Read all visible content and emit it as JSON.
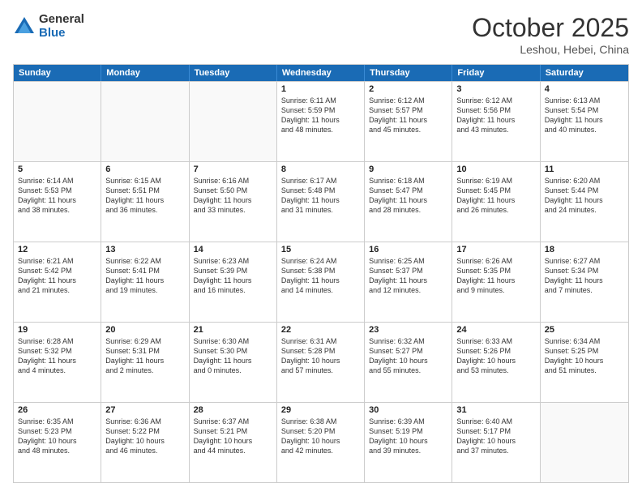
{
  "logo": {
    "general": "General",
    "blue": "Blue"
  },
  "title": "October 2025",
  "subtitle": "Leshou, Hebei, China",
  "days": [
    "Sunday",
    "Monday",
    "Tuesday",
    "Wednesday",
    "Thursday",
    "Friday",
    "Saturday"
  ],
  "rows": [
    [
      {
        "day": "",
        "text": ""
      },
      {
        "day": "",
        "text": ""
      },
      {
        "day": "",
        "text": ""
      },
      {
        "day": "1",
        "text": "Sunrise: 6:11 AM\nSunset: 5:59 PM\nDaylight: 11 hours\nand 48 minutes."
      },
      {
        "day": "2",
        "text": "Sunrise: 6:12 AM\nSunset: 5:57 PM\nDaylight: 11 hours\nand 45 minutes."
      },
      {
        "day": "3",
        "text": "Sunrise: 6:12 AM\nSunset: 5:56 PM\nDaylight: 11 hours\nand 43 minutes."
      },
      {
        "day": "4",
        "text": "Sunrise: 6:13 AM\nSunset: 5:54 PM\nDaylight: 11 hours\nand 40 minutes."
      }
    ],
    [
      {
        "day": "5",
        "text": "Sunrise: 6:14 AM\nSunset: 5:53 PM\nDaylight: 11 hours\nand 38 minutes."
      },
      {
        "day": "6",
        "text": "Sunrise: 6:15 AM\nSunset: 5:51 PM\nDaylight: 11 hours\nand 36 minutes."
      },
      {
        "day": "7",
        "text": "Sunrise: 6:16 AM\nSunset: 5:50 PM\nDaylight: 11 hours\nand 33 minutes."
      },
      {
        "day": "8",
        "text": "Sunrise: 6:17 AM\nSunset: 5:48 PM\nDaylight: 11 hours\nand 31 minutes."
      },
      {
        "day": "9",
        "text": "Sunrise: 6:18 AM\nSunset: 5:47 PM\nDaylight: 11 hours\nand 28 minutes."
      },
      {
        "day": "10",
        "text": "Sunrise: 6:19 AM\nSunset: 5:45 PM\nDaylight: 11 hours\nand 26 minutes."
      },
      {
        "day": "11",
        "text": "Sunrise: 6:20 AM\nSunset: 5:44 PM\nDaylight: 11 hours\nand 24 minutes."
      }
    ],
    [
      {
        "day": "12",
        "text": "Sunrise: 6:21 AM\nSunset: 5:42 PM\nDaylight: 11 hours\nand 21 minutes."
      },
      {
        "day": "13",
        "text": "Sunrise: 6:22 AM\nSunset: 5:41 PM\nDaylight: 11 hours\nand 19 minutes."
      },
      {
        "day": "14",
        "text": "Sunrise: 6:23 AM\nSunset: 5:39 PM\nDaylight: 11 hours\nand 16 minutes."
      },
      {
        "day": "15",
        "text": "Sunrise: 6:24 AM\nSunset: 5:38 PM\nDaylight: 11 hours\nand 14 minutes."
      },
      {
        "day": "16",
        "text": "Sunrise: 6:25 AM\nSunset: 5:37 PM\nDaylight: 11 hours\nand 12 minutes."
      },
      {
        "day": "17",
        "text": "Sunrise: 6:26 AM\nSunset: 5:35 PM\nDaylight: 11 hours\nand 9 minutes."
      },
      {
        "day": "18",
        "text": "Sunrise: 6:27 AM\nSunset: 5:34 PM\nDaylight: 11 hours\nand 7 minutes."
      }
    ],
    [
      {
        "day": "19",
        "text": "Sunrise: 6:28 AM\nSunset: 5:32 PM\nDaylight: 11 hours\nand 4 minutes."
      },
      {
        "day": "20",
        "text": "Sunrise: 6:29 AM\nSunset: 5:31 PM\nDaylight: 11 hours\nand 2 minutes."
      },
      {
        "day": "21",
        "text": "Sunrise: 6:30 AM\nSunset: 5:30 PM\nDaylight: 11 hours\nand 0 minutes."
      },
      {
        "day": "22",
        "text": "Sunrise: 6:31 AM\nSunset: 5:28 PM\nDaylight: 10 hours\nand 57 minutes."
      },
      {
        "day": "23",
        "text": "Sunrise: 6:32 AM\nSunset: 5:27 PM\nDaylight: 10 hours\nand 55 minutes."
      },
      {
        "day": "24",
        "text": "Sunrise: 6:33 AM\nSunset: 5:26 PM\nDaylight: 10 hours\nand 53 minutes."
      },
      {
        "day": "25",
        "text": "Sunrise: 6:34 AM\nSunset: 5:25 PM\nDaylight: 10 hours\nand 51 minutes."
      }
    ],
    [
      {
        "day": "26",
        "text": "Sunrise: 6:35 AM\nSunset: 5:23 PM\nDaylight: 10 hours\nand 48 minutes."
      },
      {
        "day": "27",
        "text": "Sunrise: 6:36 AM\nSunset: 5:22 PM\nDaylight: 10 hours\nand 46 minutes."
      },
      {
        "day": "28",
        "text": "Sunrise: 6:37 AM\nSunset: 5:21 PM\nDaylight: 10 hours\nand 44 minutes."
      },
      {
        "day": "29",
        "text": "Sunrise: 6:38 AM\nSunset: 5:20 PM\nDaylight: 10 hours\nand 42 minutes."
      },
      {
        "day": "30",
        "text": "Sunrise: 6:39 AM\nSunset: 5:19 PM\nDaylight: 10 hours\nand 39 minutes."
      },
      {
        "day": "31",
        "text": "Sunrise: 6:40 AM\nSunset: 5:17 PM\nDaylight: 10 hours\nand 37 minutes."
      },
      {
        "day": "",
        "text": ""
      }
    ]
  ]
}
